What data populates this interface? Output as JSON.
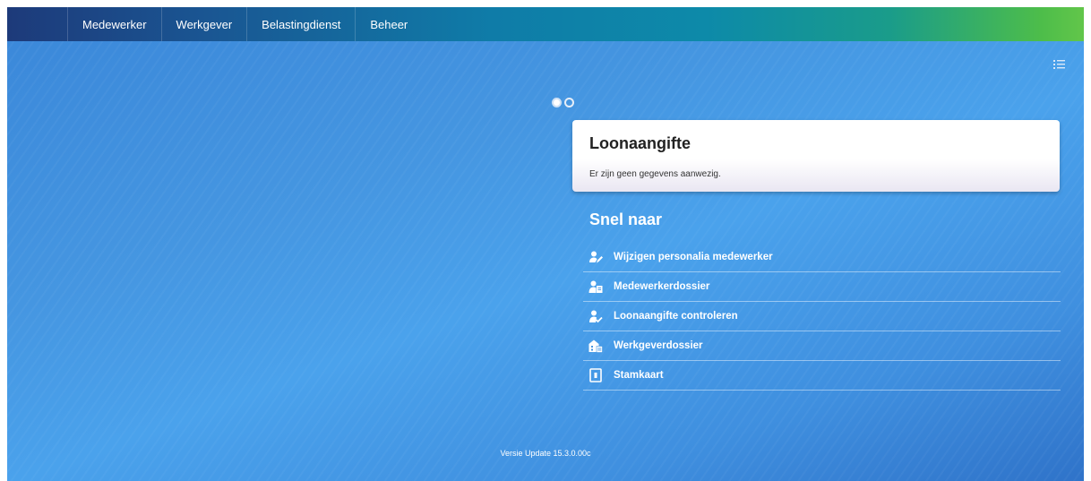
{
  "nav": {
    "items": [
      {
        "label": "Medewerker"
      },
      {
        "label": "Werkgever"
      },
      {
        "label": "Belastingdienst"
      },
      {
        "label": "Beheer"
      }
    ]
  },
  "carousel": {
    "active_index": 0,
    "count": 2
  },
  "card": {
    "title": "Loonaangifte",
    "message": "Er zijn geen gegevens aanwezig."
  },
  "quick_links": {
    "title": "Snel naar",
    "items": [
      {
        "label": "Wijzigen personalia medewerker",
        "icon": "user-edit-icon"
      },
      {
        "label": "Medewerkerdossier",
        "icon": "user-file-icon"
      },
      {
        "label": "Loonaangifte controleren",
        "icon": "user-check-icon"
      },
      {
        "label": "Werkgeverdossier",
        "icon": "building-file-icon"
      },
      {
        "label": "Stamkaart",
        "icon": "card-icon"
      }
    ]
  },
  "footer": {
    "version": "Versie Update 15.3.0.00c"
  },
  "colors": {
    "accent_green": "#62c64a",
    "nav_blue": "#1a5592",
    "background_blue": "#4596e1"
  }
}
